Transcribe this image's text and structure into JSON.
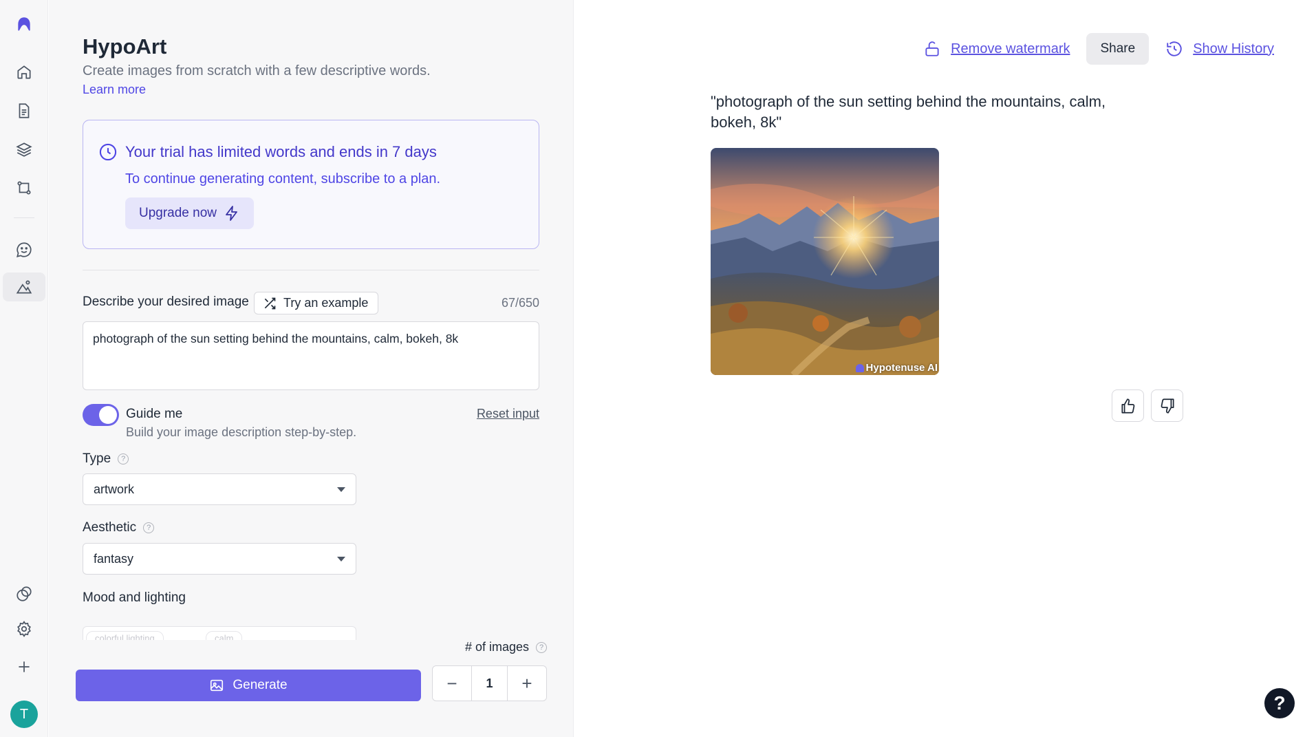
{
  "app": {
    "title": "HypoArt",
    "subtitle": "Create images from scratch with a few descriptive words.",
    "learn_more": "Learn more"
  },
  "rail": {
    "items": [
      "logo-icon",
      "home-icon",
      "document-icon",
      "layers-icon",
      "workflow-icon",
      "chat-icon",
      "image-icon",
      "brand-icon",
      "gear-icon",
      "plus-icon"
    ],
    "avatar_initial": "T",
    "avatar_color": "#1aa39c"
  },
  "trial": {
    "heading": "Your trial has limited words and ends in 7 days",
    "body": "To continue generating content, subscribe to a plan.",
    "upgrade_label": "Upgrade now"
  },
  "form": {
    "describe_label": "Describe your desired image",
    "try_example_label": "Try an example",
    "counter": "67/650",
    "prompt_value": "photograph of the sun setting behind the mountains, calm, bokeh, 8k",
    "guide_me": {
      "title": "Guide me",
      "subtitle": "Build your image description step-by-step.",
      "enabled": true
    },
    "reset_label": "Reset input",
    "type": {
      "label": "Type",
      "value": "artwork"
    },
    "aesthetic": {
      "label": "Aesthetic",
      "value": "fantasy"
    },
    "mood": {
      "label": "Mood and lighting",
      "chips": [
        "colorful lighting",
        "calm"
      ]
    },
    "num_images": {
      "label": "# of images",
      "value": "1"
    },
    "generate_label": "Generate"
  },
  "result": {
    "remove_watermark": "Remove watermark",
    "share": "Share",
    "show_history": "Show History",
    "prompt_echo": "\"photograph of the sun setting behind the mountains, calm, bokeh, 8k\"",
    "watermark": "Hypotenuse AI"
  },
  "colors": {
    "accent": "#6c63e8",
    "accent_text": "#4f46e5",
    "panel_bg": "#f7f7f8"
  }
}
